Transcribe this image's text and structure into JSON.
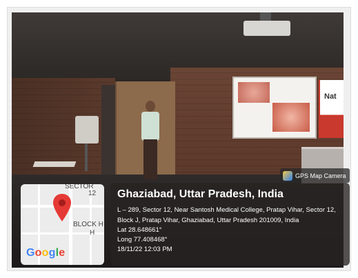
{
  "badge": {
    "label": "GPS Map Camera",
    "icon": "gps-map-camera-icon"
  },
  "map": {
    "labels": [
      "SECTOR",
      "12",
      "BLOCK H",
      "H"
    ],
    "logo": "Google",
    "pin_icon": "location-pin-icon",
    "pin_color": "#e53935"
  },
  "location": {
    "title": "Ghaziabad, Uttar Pradesh, India",
    "address": "L – 289, Sector 12, Near Santosh Medical College, Pratap Vihar, Sector 12, Block J, Pratap Vihar, Ghaziabad, Uttar Pradesh 201009, India",
    "lat": "Lat 28.648661°",
    "long": "Long 77.408468°",
    "datetime": "18/11/22 12:03 PM"
  },
  "scene": {
    "banner_text": "Nat"
  }
}
